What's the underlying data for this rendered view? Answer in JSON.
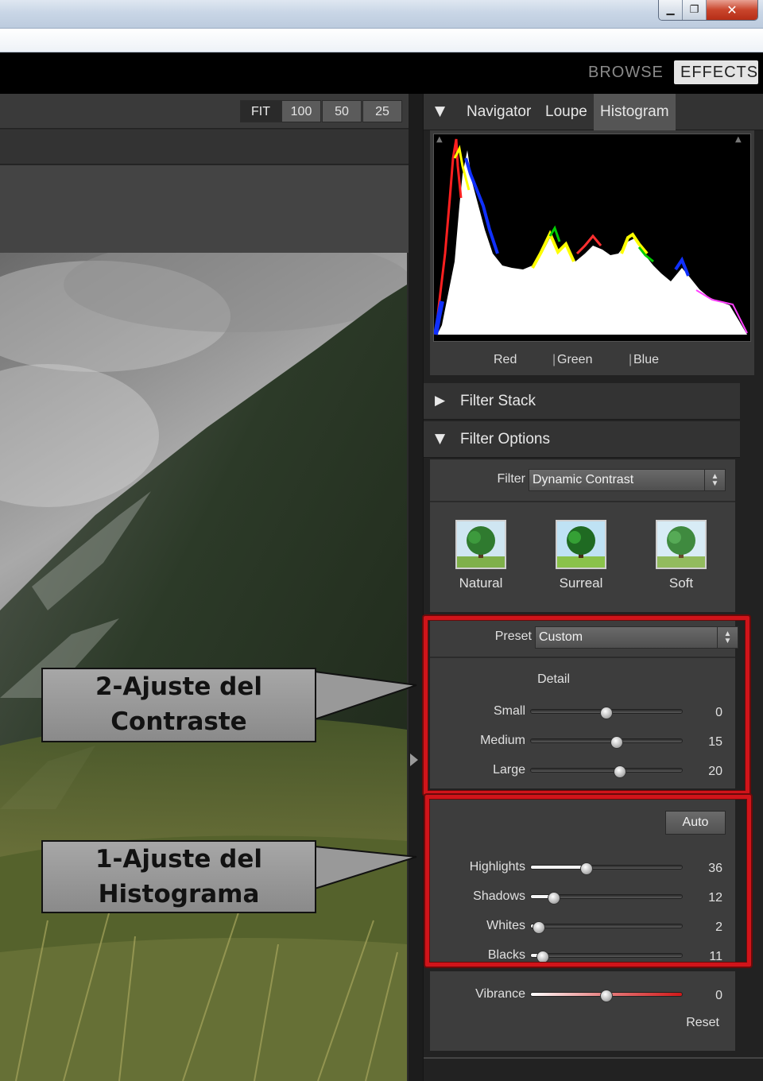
{
  "window": {
    "controls": {
      "minimize": "▁",
      "restore": "❐",
      "close": "✕"
    }
  },
  "modes": {
    "browse": "BROWSE",
    "effects": "EFFECTS"
  },
  "zoom": {
    "fit": "FIT",
    "levels": [
      "100",
      "50",
      "25"
    ]
  },
  "callouts": [
    {
      "title_line1": "2-Ajuste del",
      "title_line2": "Contraste"
    },
    {
      "title_line1": "1-Ajuste del",
      "title_line2": "Histograma"
    }
  ],
  "navigator": {
    "tabs": [
      "Navigator",
      "Loupe",
      "Histogram"
    ],
    "active_tab": "Histogram",
    "channels": [
      "Red",
      "Green",
      "Blue"
    ]
  },
  "filter_stack": {
    "title": "Filter Stack"
  },
  "filter_options": {
    "title": "Filter Options",
    "filter_label": "Filter",
    "filter_value": "Dynamic Contrast",
    "styles": [
      "Natural",
      "Surreal",
      "Soft"
    ],
    "preset_label": "Preset",
    "preset_value": "Custom",
    "detail_label": "Detail",
    "detail": [
      {
        "label": "Small",
        "value": 0,
        "level": 0.5
      },
      {
        "label": "Medium",
        "value": 15,
        "level": 0.57
      },
      {
        "label": "Large",
        "value": 20,
        "level": 0.59
      }
    ],
    "auto_label": "Auto",
    "tones": [
      {
        "label": "Highlights",
        "value": 36,
        "level": 0.37
      },
      {
        "label": "Shadows",
        "value": 12,
        "level": 0.15
      },
      {
        "label": "Whites",
        "value": 2,
        "level": 0.05
      },
      {
        "label": "Blacks",
        "value": 11,
        "level": 0.08
      }
    ],
    "vibrance": {
      "label": "Vibrance",
      "value": 0,
      "level": 0.5
    },
    "reset_label": "Reset"
  },
  "colors": {
    "annotation_red": "#d0141a",
    "panel": "#3d3d3d",
    "background": "#222222"
  }
}
